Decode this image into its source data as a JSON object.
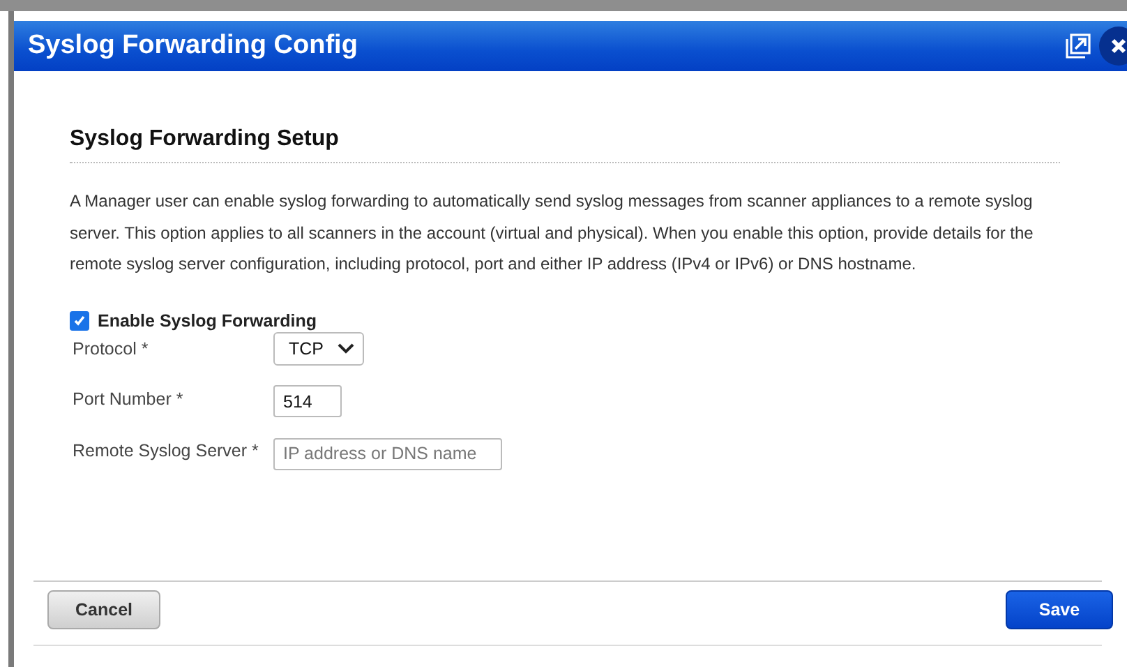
{
  "window": {
    "title": "Syslog Forwarding Config"
  },
  "section": {
    "title": "Syslog Forwarding Setup",
    "description": "A Manager user can enable syslog forwarding to automatically send syslog messages from scanner appliances to a remote syslog server. This option applies to all scanners in the account (virtual and physical). When you enable this option, provide details for the remote syslog server configuration, including protocol, port and either IP address (IPv4 or IPv6) or DNS hostname."
  },
  "enable": {
    "label": "Enable Syslog Forwarding",
    "checked": true
  },
  "fields": [
    {
      "kind": "select",
      "label": "Protocol *",
      "value": "TCP"
    },
    {
      "kind": "input",
      "label": "Port Number *",
      "value": "514"
    },
    {
      "kind": "input",
      "label": "Remote Syslog Server *",
      "placeholder": "IP address or DNS name"
    }
  ],
  "buttons": {
    "cancel": "Cancel",
    "save": "Save"
  }
}
